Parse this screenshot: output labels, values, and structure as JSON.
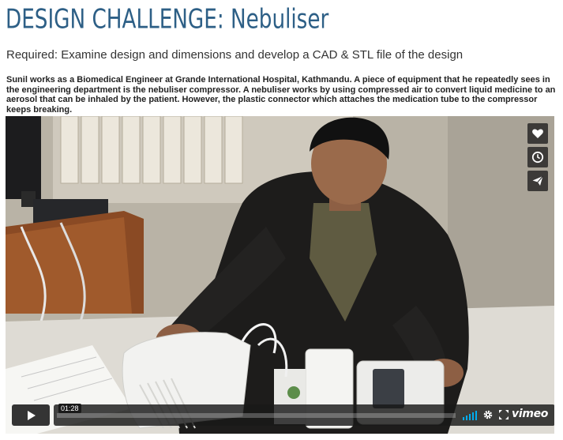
{
  "page": {
    "title": "DESIGN CHALLENGE: Nebuliser",
    "subtitle": "Required: Examine design and dimensions and develop a CAD & STL file of the design",
    "description": "Sunil works as a Biomedical Engineer at Grande International Hospital, Kathmandu. A piece of equipment that he repeatedly sees in the engineering department is the nebuliser compressor. A nebuliser works by using compressed air to convert liquid medicine to an aerosol that can be inhaled by the patient. However, the plastic connector which attaches the medication tube to the compressor keeps breaking."
  },
  "player": {
    "side_buttons": [
      "heart-icon",
      "clock-icon",
      "paper-plane-icon"
    ],
    "timecode": "01:28",
    "progress_fraction": 0.0,
    "brand": "vimeo",
    "accent_color": "#00adef"
  }
}
